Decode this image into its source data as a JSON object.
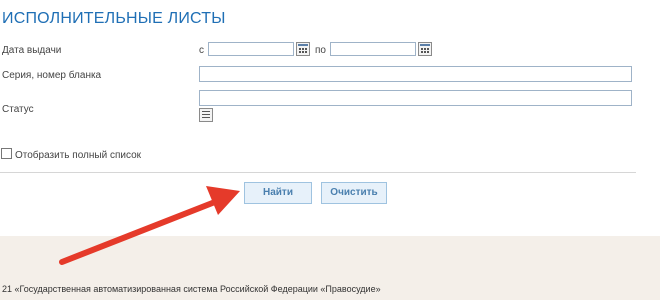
{
  "title": "ИСПОЛНИТЕЛЬНЫЕ ЛИСТЫ",
  "fields": {
    "issue_date_label": "Дата выдачи",
    "from_label": "с",
    "to_label": "по",
    "from_value": "",
    "to_value": "",
    "series_label": "Серия, номер бланка",
    "series_value": "",
    "status_label": "Статус",
    "status_value": ""
  },
  "full_list": {
    "label": "Отобразить полный список",
    "checked": false
  },
  "buttons": {
    "find": "Найти",
    "clear": "Очистить"
  },
  "footer": {
    "text": "21 «Государственная автоматизированная система Российской Федерации «Правосудие»"
  },
  "colors": {
    "title": "#1f6fb5",
    "button_bg": "#e7f1fa",
    "button_text": "#4a7fae",
    "arrow": "#e53a2a"
  },
  "icons": {
    "calendar": "calendar-icon",
    "list": "list-icon",
    "arrow": "arrow-icon"
  }
}
